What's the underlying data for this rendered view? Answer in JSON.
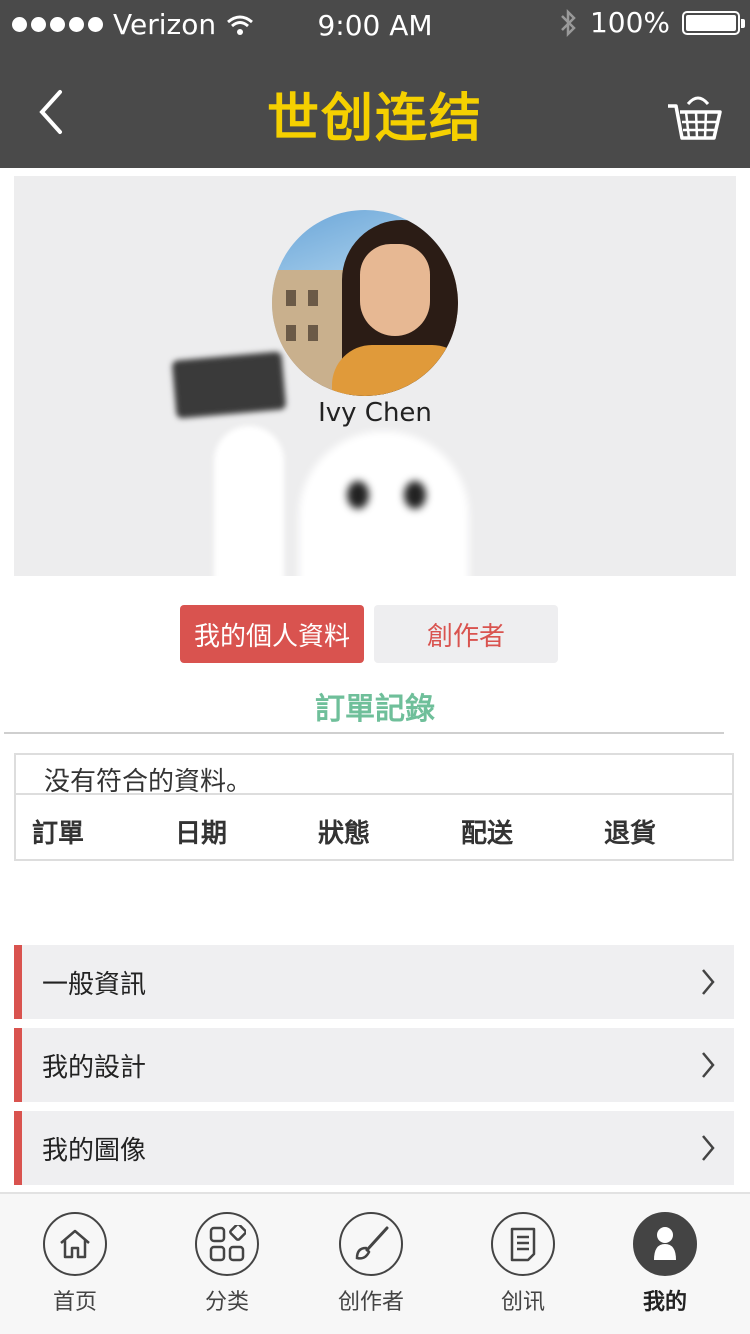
{
  "status_bar": {
    "carrier": "Verizon",
    "time": "9:00 AM",
    "battery": "100%",
    "battery_level": 1.0
  },
  "nav": {
    "title": "世创连结",
    "back_icon": "chevron-left-icon",
    "cart_icon": "basket-icon"
  },
  "profile": {
    "name": "Ivy Chen"
  },
  "segments": {
    "active": "我的個人資料",
    "inactive": "創作者"
  },
  "orders": {
    "title": "訂單記錄",
    "empty_message": "没有符合的資料。",
    "columns": [
      "訂單",
      "日期",
      "狀態",
      "配送",
      "退貨"
    ]
  },
  "menu": [
    {
      "label": "一般資訊"
    },
    {
      "label": "我的設計"
    },
    {
      "label": "我的圖像"
    }
  ],
  "tabbar": [
    {
      "label": "首页",
      "icon": "home-icon"
    },
    {
      "label": "分类",
      "icon": "category-icon"
    },
    {
      "label": "创作者",
      "icon": "brush-icon"
    },
    {
      "label": "创讯",
      "icon": "document-icon"
    },
    {
      "label": "我的",
      "icon": "user-icon"
    }
  ],
  "colors": {
    "accent": "#d9534f",
    "title_yellow": "#f5d000",
    "section_green": "#6fbf9a",
    "bar_dark": "#4a4a4a"
  }
}
